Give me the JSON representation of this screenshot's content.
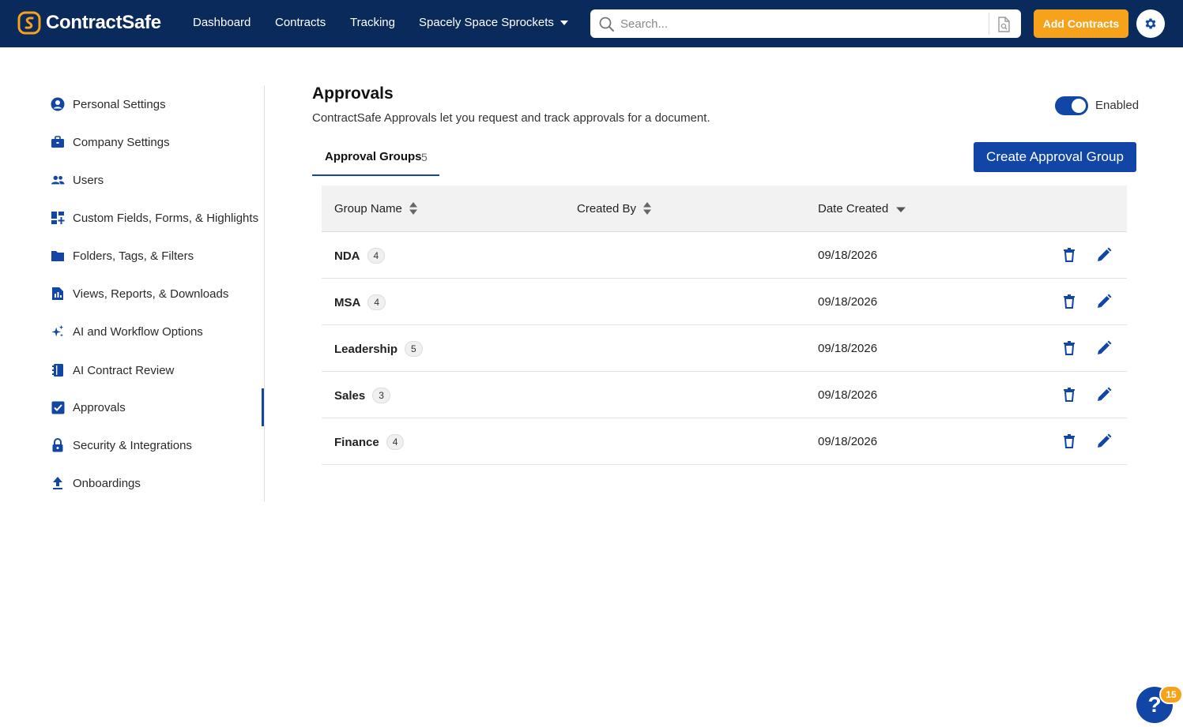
{
  "app": {
    "name": "ContractSafe"
  },
  "nav": {
    "dashboard": "Dashboard",
    "contracts": "Contracts",
    "tracking": "Tracking",
    "company": "Spacely Space Sprockets",
    "search_placeholder": "Search...",
    "add_contracts": "Add Contracts"
  },
  "sidebar": {
    "items": [
      {
        "label": "Personal Settings",
        "icon": "user-circle-icon"
      },
      {
        "label": "Company Settings",
        "icon": "briefcase-icon"
      },
      {
        "label": "Users",
        "icon": "users-icon"
      },
      {
        "label": "Custom Fields, Forms, & Highlights",
        "icon": "dashboard-add-icon"
      },
      {
        "label": "Folders, Tags, & Filters",
        "icon": "folder-icon"
      },
      {
        "label": "Views, Reports, & Downloads",
        "icon": "report-icon"
      },
      {
        "label": "AI and Workflow Options",
        "icon": "sparkles-icon"
      },
      {
        "label": "AI Contract Review",
        "icon": "book-icon"
      },
      {
        "label": "Approvals",
        "icon": "checkbox-icon"
      },
      {
        "label": "Security & Integrations",
        "icon": "lock-icon"
      },
      {
        "label": "Onboardings",
        "icon": "upload-icon"
      }
    ],
    "active": "Approvals"
  },
  "main": {
    "title": "Approvals",
    "description": "ContractSafe Approvals let you request and track approvals for a document.",
    "toggle_label": "Enabled",
    "toggle_on": true,
    "tab_label": "Approval Groups",
    "tab_count": "5",
    "create_button": "Create Approval Group"
  },
  "table": {
    "columns": [
      "Group Name",
      "Created By",
      "Date Created"
    ],
    "rows": [
      {
        "name": "NDA",
        "count": "4",
        "created_by": "",
        "date": "09/18/2026"
      },
      {
        "name": "MSA",
        "count": "4",
        "created_by": "",
        "date": "09/18/2026"
      },
      {
        "name": "Leadership",
        "count": "5",
        "created_by": "",
        "date": "09/18/2026"
      },
      {
        "name": "Sales",
        "count": "3",
        "created_by": "",
        "date": "09/18/2026"
      },
      {
        "name": "Finance",
        "count": "4",
        "created_by": "",
        "date": "09/18/2026"
      }
    ]
  },
  "help": {
    "badge": "15"
  },
  "colors": {
    "navy": "#0b2a5c",
    "primary": "#1145a6",
    "accent": "#f7a21b"
  }
}
